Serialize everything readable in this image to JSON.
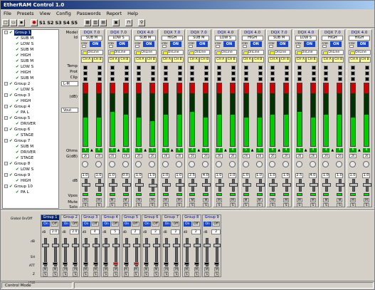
{
  "window": {
    "title": "EtherRAM Control 1.0"
  },
  "menu": [
    "File",
    "Presets",
    "View",
    "Config",
    "Passwords",
    "Report",
    "Help"
  ],
  "toolbar": {
    "scene_buttons": [
      "S1",
      "S2",
      "S3",
      "S4",
      "S5"
    ]
  },
  "tree": [
    {
      "group": "Group 1",
      "selected": true,
      "items": [
        "SUB M",
        "LOW S",
        "SUB M",
        "HIGH",
        "SUB M",
        "LOW S",
        "HIGH",
        "SUB M"
      ]
    },
    {
      "group": "Group 2",
      "items": [
        "LOW S"
      ]
    },
    {
      "group": "Group 3",
      "items": [
        "HIGH"
      ]
    },
    {
      "group": "Group 4",
      "items": [
        "PA L"
      ]
    },
    {
      "group": "Group 5",
      "items": [
        "DRIVER"
      ]
    },
    {
      "group": "Group 6",
      "items": [
        "STAGE"
      ]
    },
    {
      "group": "Group 7",
      "items": [
        "SUB M",
        "DRIVER",
        "STAGE"
      ]
    },
    {
      "group": "Group 8",
      "items": [
        "LOW S"
      ]
    },
    {
      "group": "Group 9",
      "items": [
        "HIGH"
      ]
    },
    {
      "group": "Group 10",
      "items": [
        "PA L"
      ]
    }
  ],
  "row_labels": {
    "model": "Model",
    "id": "Id",
    "temp": "Temp",
    "prot": "Prot",
    "clip": "Clip",
    "select1": "L-M",
    "db": "(dB)",
    "select2": "Vout",
    "ohms": "Ohms",
    "gdb": "G(dB)",
    "dbrow": "dB",
    "vpos": "Vpos",
    "mute": "Mute",
    "solo": "Solo"
  },
  "strips": [
    {
      "model": "DQX 7.0",
      "id": "SUB M",
      "stby": "STBY",
      "on": "ON",
      "online": "OnLine",
      "ch": [
        "CH A",
        "CH B"
      ],
      "ohms": [
        "5",
        "4"
      ],
      "g": [
        "26",
        "26"
      ],
      "db": [
        "1.0",
        "1.0"
      ],
      "lvl": [
        0.45,
        0.45
      ]
    },
    {
      "model": "DQX 7.0",
      "id": "LOW S",
      "stby": "STBY",
      "on": "ON",
      "online": "OnLine",
      "ch": [
        "CH A",
        "CH B"
      ],
      "ohms": [
        "4",
        "4"
      ],
      "g": [
        "26",
        "26"
      ],
      "db": [
        "1.0",
        "0.0"
      ],
      "lvl": [
        0.55,
        0.5
      ]
    },
    {
      "model": "DQX 4.0",
      "id": "SUB M",
      "stby": "STBY",
      "on": "ON",
      "online": "OnLine",
      "ch": [
        "CH A",
        "CH B"
      ],
      "ohms": [
        "5",
        "5"
      ],
      "g": [
        "26",
        "26"
      ],
      "db": [
        "1.0",
        "1.0"
      ],
      "lvl": [
        0.45,
        0.4
      ]
    },
    {
      "model": "DQX 7.0",
      "id": "HIGH",
      "stby": "STBY",
      "on": "ON",
      "online": "OnLine",
      "ch": [
        "CH A",
        "CH B"
      ],
      "ohms": [
        "6",
        "6"
      ],
      "g": [
        "26",
        "26"
      ],
      "db": [
        "1.0",
        "1.0"
      ],
      "lvl": [
        0.5,
        0.5
      ]
    },
    {
      "model": "DQX 7.0",
      "id": "SUB M",
      "stby": "STBY",
      "on": "ON",
      "online": "OnLine",
      "ch": [
        "CH A",
        "CH B"
      ],
      "ohms": [
        "4",
        "5"
      ],
      "g": [
        "26",
        "26"
      ],
      "db": [
        "2.5",
        "4.0"
      ],
      "lvl": [
        0.55,
        0.45
      ]
    },
    {
      "model": "DQX 4.0",
      "id": "LOW S",
      "stby": "STBY",
      "on": "ON",
      "online": "OnLine",
      "ch": [
        "CH A",
        "CH B"
      ],
      "ohms": [
        "2",
        "4"
      ],
      "g": [
        "26",
        "26"
      ],
      "db": [
        "1.0",
        "1.0"
      ],
      "lvl": [
        0.5,
        0.5
      ]
    },
    {
      "model": "DQX 4.0",
      "id": "HIGH",
      "stby": "STBY",
      "on": "ON",
      "online": "OnLine",
      "ch": [
        "CH A",
        "CH B"
      ],
      "ohms": [
        "5",
        "5"
      ],
      "g": [
        "26",
        "26"
      ],
      "db": [
        "1.0",
        "1.0"
      ],
      "lvl": [
        0.45,
        0.45
      ]
    },
    {
      "model": "DQX 7.0",
      "id": "SUB M",
      "stby": "STBY",
      "on": "ON",
      "online": "OnLine",
      "ch": [
        "CH A",
        "CH B"
      ],
      "ohms": [
        "6",
        "4"
      ],
      "g": [
        "26",
        "26"
      ],
      "db": [
        "1.0",
        "1.0"
      ],
      "lvl": [
        0.5,
        0.5
      ]
    },
    {
      "model": "DQX 4.0",
      "id": "LOW S",
      "stby": "STBY",
      "on": "ON",
      "online": "OnLine",
      "ch": [
        "CH A",
        "CH B"
      ],
      "ohms": [
        "5",
        "4"
      ],
      "g": [
        "26",
        "26"
      ],
      "db": [
        "2.5",
        "4.0"
      ],
      "lvl": [
        0.55,
        0.45
      ]
    },
    {
      "model": "DQX 7.0",
      "id": "HIGH",
      "stby": "STBY",
      "on": "ON",
      "online": "OnLine",
      "ch": [
        "CH A",
        "CH B"
      ],
      "ohms": [
        "4",
        "4"
      ],
      "g": [
        "26",
        "26"
      ],
      "db": [
        "1.0",
        "1.0"
      ],
      "lvl": [
        0.5,
        0.5
      ]
    },
    {
      "model": "DQX 4.0",
      "id": "HIGH",
      "stby": "STBY",
      "on": "ON",
      "online": "OnLine",
      "ch": [
        "CH A",
        "CH B"
      ],
      "ohms": [
        "6",
        "4"
      ],
      "g": [
        "26",
        "26"
      ],
      "db": [
        "1.0",
        "1.0"
      ],
      "lvl": [
        0.45,
        0.5
      ]
    }
  ],
  "global": {
    "title": "Global On/Off",
    "labels": {
      "db": "dB",
      "sh": "SH",
      "att": "ATT",
      "z": "Z",
      "prot": "Prot"
    }
  },
  "groups_panel": [
    {
      "name": "Group 1",
      "selected": true,
      "on": "On",
      "off": "Off",
      "db": "2.0",
      "red": [
        false,
        false
      ]
    },
    {
      "name": "Group 2",
      "on": "On",
      "off": "Off",
      "db": "2.0",
      "red": [
        false,
        false
      ]
    },
    {
      "name": "Group 3",
      "on": "On",
      "off": "Off",
      "db": "4",
      "red": [
        false,
        false
      ]
    },
    {
      "name": "Group 4",
      "on": "On",
      "off": "Off",
      "db": "5",
      "red": [
        false,
        true
      ]
    },
    {
      "name": "Group 5",
      "on": "On",
      "off": "Off",
      "db": "2",
      "red": [
        false,
        true
      ]
    },
    {
      "name": "Group 6",
      "on": "On",
      "off": "Off",
      "db": "2",
      "red": [
        false,
        false
      ]
    },
    {
      "name": "Group 7",
      "on": "On",
      "off": "Off",
      "db": "2",
      "red": [
        false,
        false
      ]
    },
    {
      "name": "Group 8",
      "on": "On",
      "off": "Off",
      "db": "2",
      "red": [
        false,
        false
      ]
    },
    {
      "name": "Group 9",
      "on": "On",
      "off": "Off",
      "db": "2",
      "red": [
        false,
        false
      ]
    }
  ],
  "statusbar": {
    "mode": "Control Mode"
  },
  "colors": {
    "title_bar": "#0a246a",
    "on_button": "#1848c8",
    "meter_green": "#00cc00",
    "meter_red": "#cc0000"
  }
}
